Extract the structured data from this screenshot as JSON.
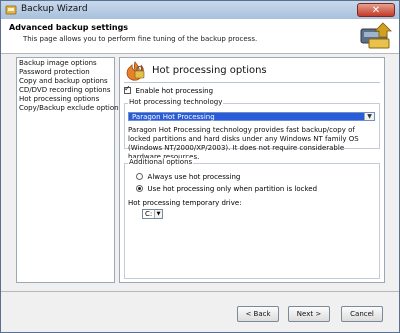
{
  "window": {
    "title": "Backup Wizard",
    "close_glyph": "✕"
  },
  "header": {
    "title": "Advanced backup settings",
    "subtitle": "This page allows you to perform fine tuning of the backup process."
  },
  "nav": {
    "items": [
      {
        "label": "Backup image options"
      },
      {
        "label": "Password protection"
      },
      {
        "label": "Copy and backup options"
      },
      {
        "label": "CD/DVD recording options"
      },
      {
        "label": "Hot processing options"
      },
      {
        "label": "Copy/Backup exclude options"
      }
    ]
  },
  "panel": {
    "title": "Hot processing options",
    "enable_label": "Enable hot processing",
    "enable_checked": true,
    "technology_group": "Hot processing technology",
    "technology_value": "Paragon Hot Processing",
    "technology_description": "Paragon Hot Processing technology provides fast backup/copy of locked partitions and hard disks under any Windows NT family OS (Windows NT/2000/XP/2003). It does not require considerable hardware resources.",
    "additional_group": "Additional options",
    "radio_always": "Always use hot processing",
    "radio_locked": "Use hot processing only when partition is locked",
    "selected_radio": "locked",
    "drive_label": "Hot processing temporary drive:",
    "drive_value": "C:"
  },
  "buttons": {
    "back": "< Back",
    "next": "Next >",
    "cancel": "Cancel"
  },
  "colors": {
    "selection": "#2a5bd8",
    "title_bar": "#b7cce6"
  }
}
